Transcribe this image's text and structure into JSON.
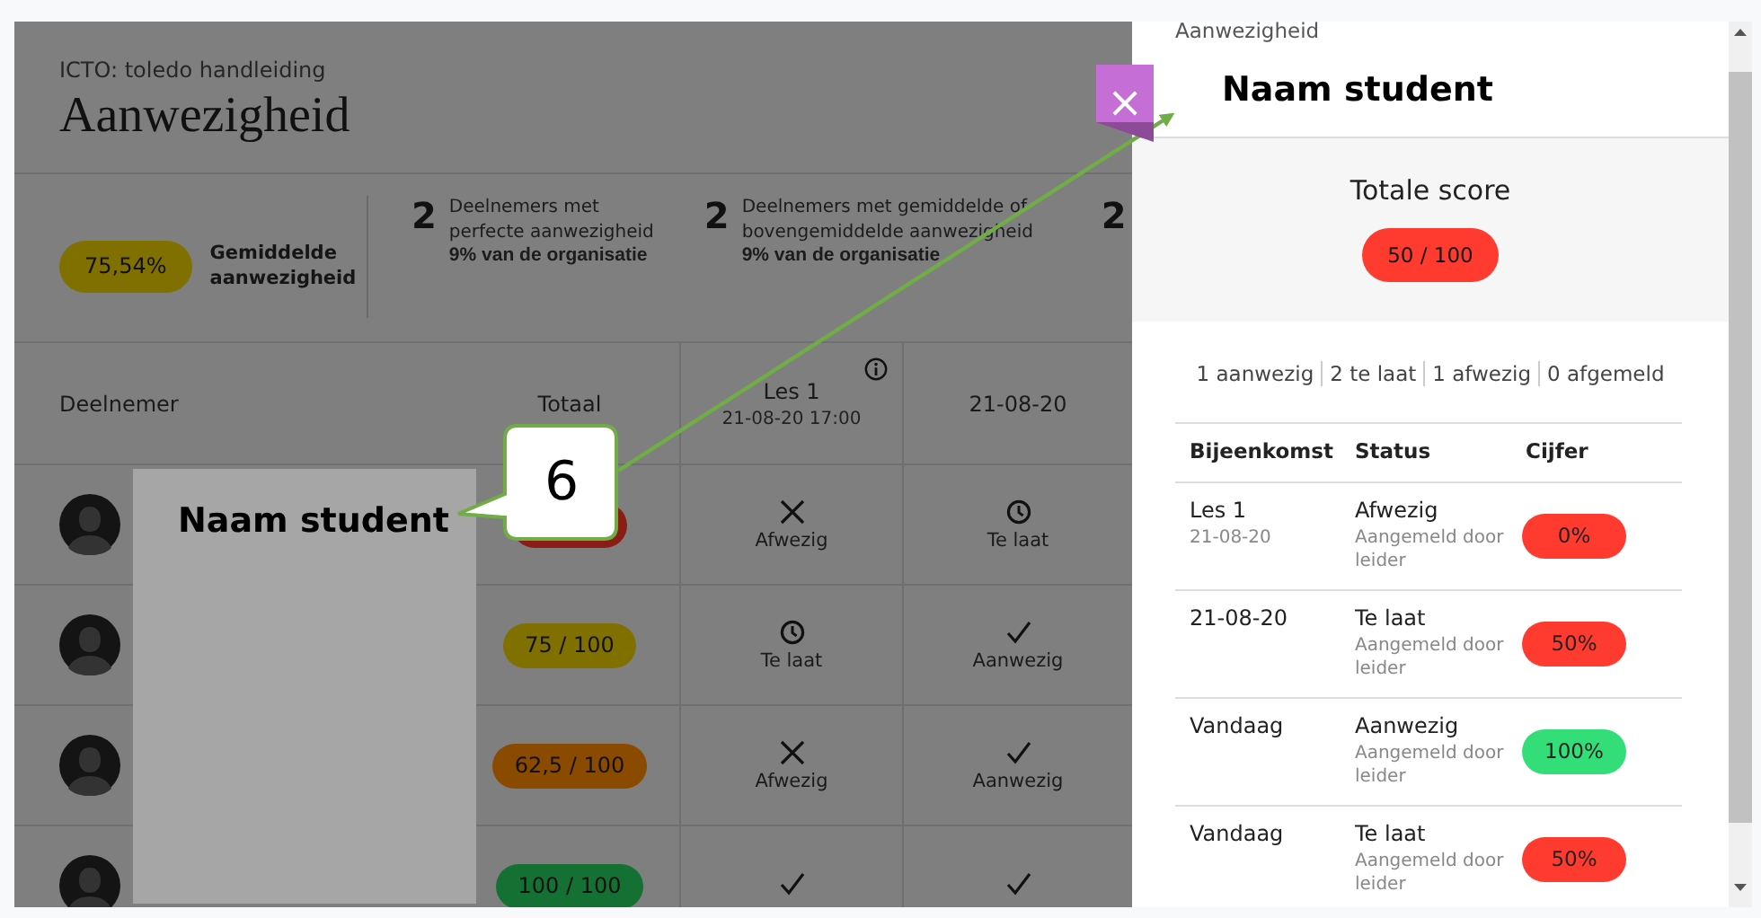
{
  "app": {
    "breadcrumb": "ICTO: toledo handleiding",
    "title": "Aanwezigheid",
    "stats": {
      "average": {
        "value": "75,54%",
        "color": "#807000",
        "label": "Gemiddelde aanwezigheid"
      },
      "items": [
        {
          "count": "2",
          "text": "Deelnemers met perfecte aanwezigheid",
          "subtext": "9% van de organisatie"
        },
        {
          "count": "2",
          "text": "Deelnemers met gemiddelde of bovengemiddelde aanwezigheid",
          "subtext": "9% van de organisatie"
        },
        {
          "count": "2"
        }
      ]
    },
    "table": {
      "columns": [
        {
          "label": "Deelnemer"
        },
        {
          "label": "Totaal"
        },
        {
          "label": "Les 1",
          "sublabel": "21-08-20 17:00",
          "info": true
        },
        {
          "label": "21-08-20"
        }
      ],
      "rows": [
        {
          "total": {
            "color": "#8b1d17"
          },
          "cells": [
            {
              "kind": "absent",
              "label": "Afwezig"
            },
            {
              "kind": "late",
              "label": "Te laat"
            }
          ]
        },
        {
          "total": {
            "value": "75 / 100",
            "color": "#807000"
          },
          "cells": [
            {
              "kind": "late",
              "label": "Te laat"
            },
            {
              "kind": "present",
              "label": "Aanwezig"
            }
          ]
        },
        {
          "total": {
            "value": "62,5 / 100",
            "color": "#8a4a00"
          },
          "cells": [
            {
              "kind": "absent",
              "label": "Afwezig"
            },
            {
              "kind": "present",
              "label": "Aanwezig"
            }
          ]
        },
        {
          "total": {
            "value": "100 / 100",
            "color": "#157033"
          },
          "cells": [
            {
              "kind": "present"
            },
            {
              "kind": "present"
            }
          ]
        }
      ]
    }
  },
  "panel": {
    "eyebrow": "Aanwezigheid",
    "title": "Naam student",
    "close": "×",
    "score": {
      "label": "Totale score",
      "value": "50 / 100",
      "color": "#ff3b30"
    },
    "summary": [
      "1 aanwezig",
      "2 te laat",
      "1 afwezig",
      "0 afgemeld"
    ],
    "columns": [
      "Bijeenkomst",
      "Status",
      "Cijfer"
    ],
    "rows": [
      {
        "session": "Les 1",
        "date": "21-08-20",
        "status": "Afwezig",
        "note": "Aangemeld door leider",
        "grade": "0%",
        "color": "#ff3b30"
      },
      {
        "session": "21-08-20",
        "status": "Te laat",
        "note": "Aangemeld door leider",
        "grade": "50%",
        "color": "#ff3b30"
      },
      {
        "session": "Vandaag",
        "status": "Aanwezig",
        "note": "Aangemeld door leider",
        "grade": "100%",
        "color": "#33dd77"
      },
      {
        "session": "Vandaag",
        "status": "Te laat",
        "note": "Aangemeld door leider",
        "grade": "50%",
        "color": "#ff3b30"
      }
    ]
  },
  "annotations": {
    "callout": "6",
    "redaction": "Naam student"
  }
}
